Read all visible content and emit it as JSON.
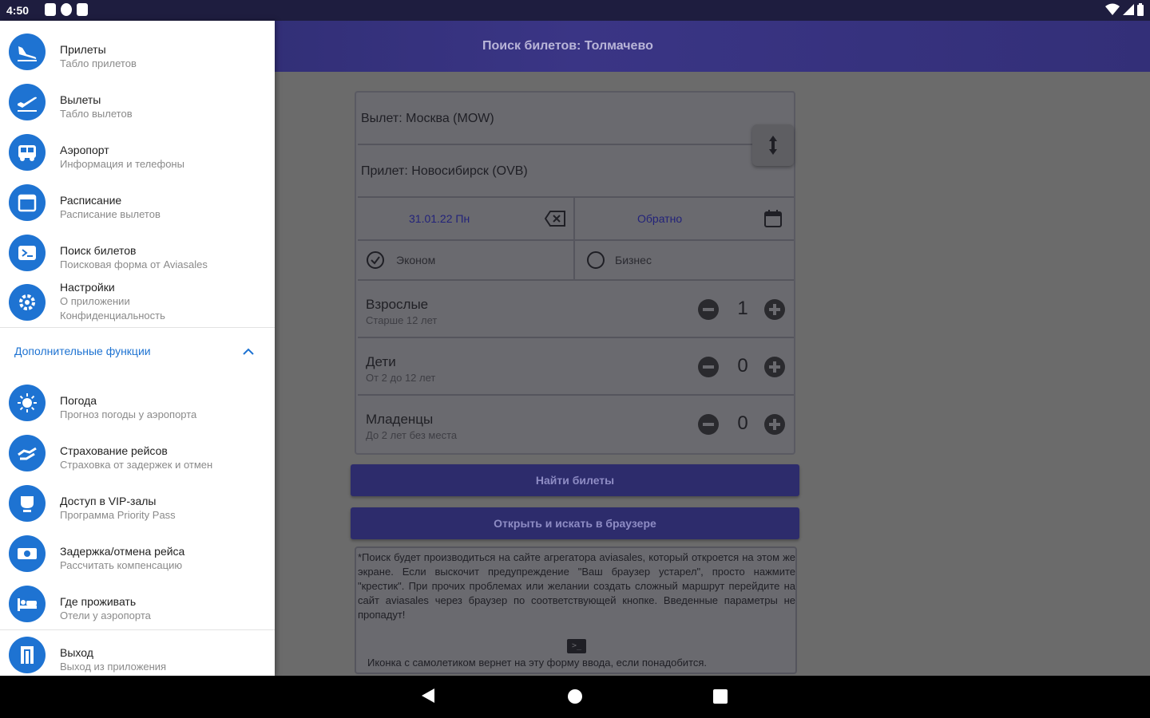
{
  "status_bar": {
    "time": "4:50"
  },
  "app_bar": {
    "title": "Поиск билетов: Толмачево"
  },
  "form": {
    "departure": "Вылет: Москва (MOW)",
    "arrival": "Прилет: Новосибирск (OVB)",
    "date_there": "31.01.22 Пн",
    "date_back": "Обратно",
    "class_economy": "Эконом",
    "class_business": "Бизнес",
    "passengers": [
      {
        "title": "Взрослые",
        "subtitle": "Старше 12 лет",
        "count": "1"
      },
      {
        "title": "Дети",
        "subtitle": "От 2 до 12 лет",
        "count": "0"
      },
      {
        "title": "Младенцы",
        "subtitle": "До 2 лет без места",
        "count": "0"
      }
    ]
  },
  "buttons": {
    "find": "Найти билеты",
    "open_browser": "Открыть и искать в браузере"
  },
  "notice": {
    "text": "*Поиск будет производиться на сайте агрегатора aviasales, который откроется на этом же экране. Если выскочит предупреждение \"Ваш браузер устарел\", просто нажмите \"крестик\". При прочих проблемах или желании создать сложный маршрут перейдите на сайт aviasales через браузер по соответствующей кнопке. Введенные параметры не пропадут!",
    "footer": "Иконка с самолетиком вернет на эту форму ввода, если понадобится."
  },
  "drawer": {
    "items": [
      {
        "title": "Прилеты",
        "subtitle": "Табло прилетов",
        "icon": "plane-landing-icon"
      },
      {
        "title": "Вылеты",
        "subtitle": "Табло вылетов",
        "icon": "plane-takeoff-icon"
      },
      {
        "title": "Аэропорт",
        "subtitle": "Информация и телефоны",
        "icon": "bus-icon"
      },
      {
        "title": "Расписание",
        "subtitle": "Расписание вылетов",
        "icon": "calendar-icon"
      },
      {
        "title": "Поиск билетов",
        "subtitle": "Поисковая форма от Aviasales",
        "icon": "ticket-search-icon"
      },
      {
        "title": "Настройки",
        "subtitle": "О приложении",
        "subtitle2": "Конфиденциальность",
        "icon": "settings-icon"
      }
    ],
    "section_label": "Дополнительные функции",
    "extra_items": [
      {
        "title": "Погода",
        "subtitle": "Прогноз погоды у аэропорта",
        "icon": "sun-icon"
      },
      {
        "title": "Страхование рейсов",
        "subtitle": "Страховка от задержек и отмен",
        "icon": "insurance-icon"
      },
      {
        "title": "Доступ в VIP-залы",
        "subtitle": "Программа Priority Pass",
        "icon": "vip-lounge-icon"
      },
      {
        "title": "Задержка/отмена рейса",
        "subtitle": "Рассчитать компенсацию",
        "icon": "money-icon"
      },
      {
        "title": "Где проживать",
        "subtitle": "Отели у аэропорта",
        "icon": "hotel-bed-icon"
      }
    ],
    "exit": {
      "title": "Выход",
      "subtitle": "Выход из приложения",
      "icon": "exit-door-icon"
    }
  },
  "colors": {
    "accent": "#1e73d2",
    "appbar": "#2b2a6b",
    "button": "#2d2c6c"
  }
}
